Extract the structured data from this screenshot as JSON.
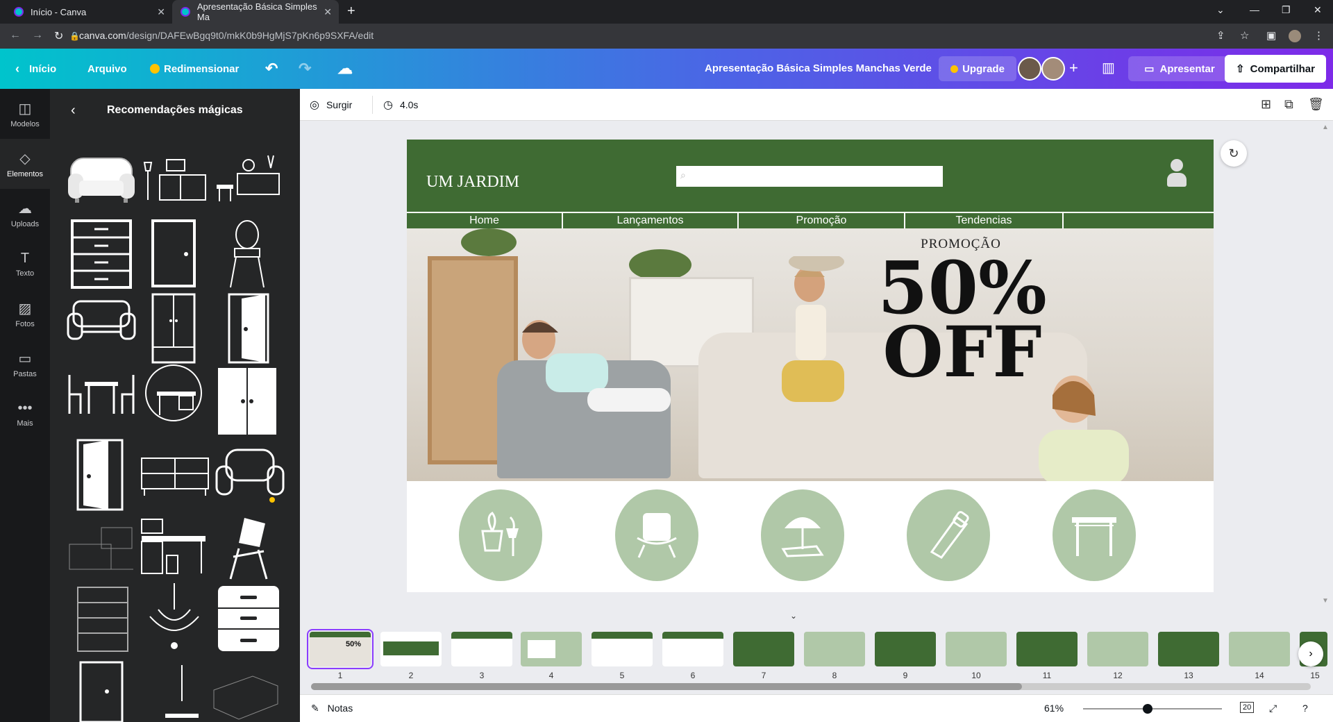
{
  "browser": {
    "tabs": [
      {
        "title": "Início - Canva"
      },
      {
        "title": "Apresentação Básica Simples Ma"
      }
    ],
    "url_host": "canva.com",
    "url_path": "/design/DAFEwBgq9t0/mkK0b9HgMjS7pKn6p9SXFA/edit"
  },
  "header": {
    "home": "Início",
    "file": "Arquivo",
    "resize": "Redimensionar",
    "doc_title": "Apresentação Básica Simples Manchas Verde",
    "upgrade": "Upgrade",
    "present": "Apresentar",
    "share": "Compartilhar"
  },
  "rail": [
    {
      "label": "Modelos",
      "icon": "templates-icon"
    },
    {
      "label": "Elementos",
      "icon": "elements-icon"
    },
    {
      "label": "Uploads",
      "icon": "upload-icon"
    },
    {
      "label": "Texto",
      "icon": "text-icon"
    },
    {
      "label": "Fotos",
      "icon": "photos-icon"
    },
    {
      "label": "Pastas",
      "icon": "folder-icon"
    },
    {
      "label": "Mais",
      "icon": "more-icon"
    }
  ],
  "panel": {
    "title": "Recomendações mágicas"
  },
  "toolbar": {
    "animation": "Surgir",
    "duration": "4.0s"
  },
  "slide": {
    "brand": "UM JARDIM",
    "nav": [
      "Home",
      "Lançamentos",
      "Promoção",
      "Tendencias"
    ],
    "promo_label": "PROMOÇÃO",
    "promo_percent": "50%",
    "promo_off": "OFF",
    "circle_icons": [
      "plant-tools-icon",
      "chair-icon",
      "beach-umbrella-icon",
      "saw-icon",
      "table-icon"
    ]
  },
  "filmstrip": {
    "pages": [
      "1",
      "2",
      "3",
      "4",
      "5",
      "6",
      "7",
      "8",
      "9",
      "10",
      "11",
      "12",
      "13",
      "14",
      "15"
    ]
  },
  "footer": {
    "notes": "Notas",
    "zoom": "61%",
    "page_count": "20"
  },
  "colors": {
    "slide_green": "#3f6b33",
    "circle_green": "#b0c8a8",
    "accent": "#8b3dff"
  }
}
